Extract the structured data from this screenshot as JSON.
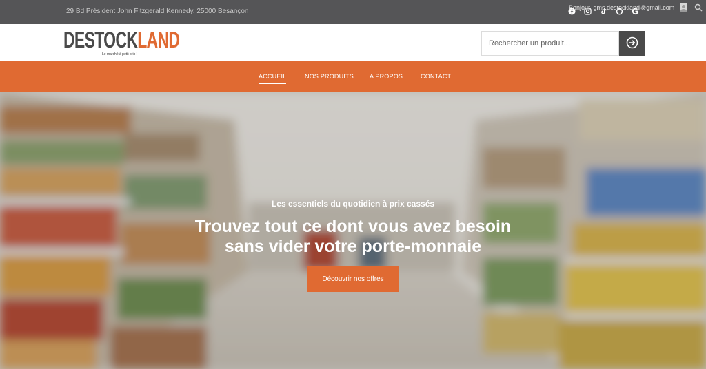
{
  "topbar": {
    "address": "29 Bd Président John Fitzgerald Kennedy, 25000 Besançon",
    "greeting": "Bonjour, gms.destockland@gmail.com",
    "social_icons": [
      "facebook-icon",
      "instagram-icon",
      "tiktok-icon",
      "shopping-icon",
      "google-icon"
    ]
  },
  "header": {
    "logo": {
      "word_main": "DESTOCK",
      "word_accent": "LAND",
      "slogan": "Le marché à petit prix !"
    },
    "search": {
      "placeholder": "Rechercher un produit..."
    }
  },
  "nav": {
    "items": [
      {
        "label": "ACCUEIL",
        "active": true
      },
      {
        "label": "NOS PRODUITS",
        "active": false
      },
      {
        "label": "A PROPOS",
        "active": false
      },
      {
        "label": "CONTACT",
        "active": false
      }
    ]
  },
  "hero": {
    "kicker": "Les essentiels du quotidien à prix cassés",
    "title_line1": "Trouvez tout ce dont vous avez besoin",
    "title_line2": "sans vider votre porte-monnaie",
    "cta_label": "Découvrir nos offres"
  },
  "colors": {
    "accent": "#e06a32",
    "topbar": "#555557",
    "dark_button": "#4a4a4a"
  }
}
